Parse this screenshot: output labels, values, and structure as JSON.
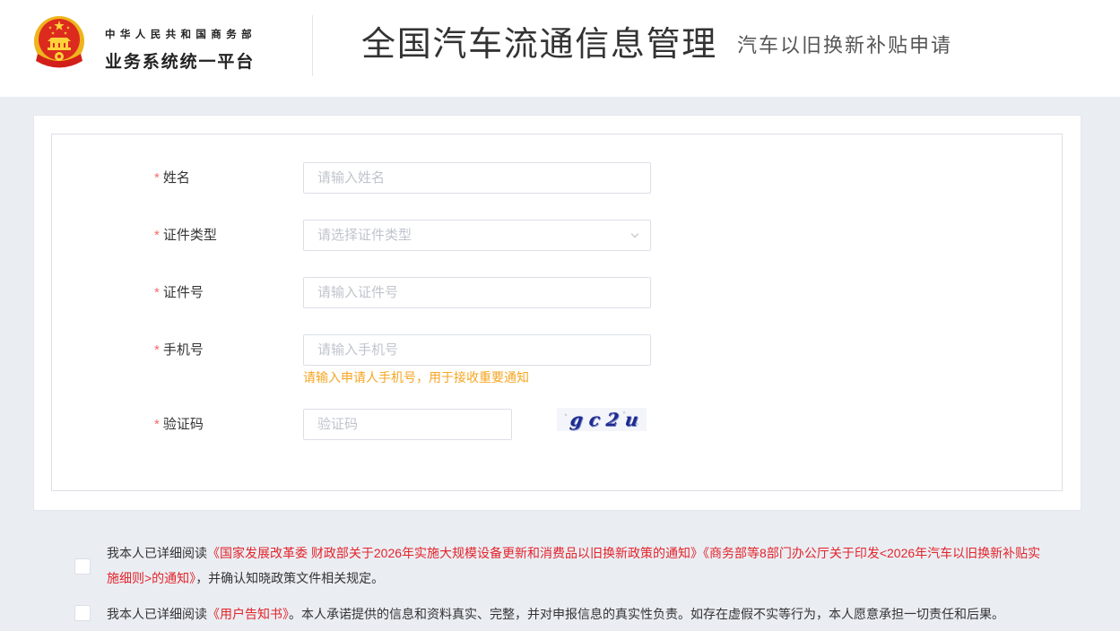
{
  "header": {
    "org_name": "中华人民共和国商务部",
    "platform_name": "业务系统统一平台",
    "title": "全国汽车流通信息管理",
    "subtitle": "汽车以旧换新补贴申请",
    "logo_icon": "national-emblem-icon"
  },
  "form": {
    "required_mark": "*",
    "fields": [
      {
        "label": "姓名",
        "placeholder": "请输入姓名"
      },
      {
        "label": "证件类型",
        "placeholder": "请选择证件类型"
      },
      {
        "label": "证件号",
        "placeholder": "请输入证件号"
      },
      {
        "label": "手机号",
        "placeholder": "请输入手机号"
      },
      {
        "label": "验证码",
        "placeholder": "验证码"
      }
    ],
    "select_icon": "chevron-down-icon",
    "phone_hint": "请输入申请人手机号，用于接收重要通知",
    "captcha_text": "gc2u"
  },
  "agreements": [
    {
      "checked": false,
      "prefix": "我本人已详细阅读",
      "links": [
        "《国家发展改革委 财政部关于2026年实施大规模设备更新和消费品以旧换新政策的通知》",
        "《商务部等8部门办公厅关于印发<2026年汽车以旧换新补贴实施细则>的通知》"
      ],
      "suffix": "，并确认知晓政策文件相关规定。"
    },
    {
      "checked": false,
      "prefix": "我本人已详细阅读",
      "links": [
        "《用户告知书》"
      ],
      "suffix": "。本人承诺提供的信息和资料真实、完整，并对申报信息的真实性负责。如存在虚假不实等行为，本人愿意承担一切责任和后果。"
    }
  ],
  "colors": {
    "link": "#e3242b",
    "required": "#f56c6c",
    "hint": "#f5a623",
    "page_bg": "#eaeef3"
  }
}
